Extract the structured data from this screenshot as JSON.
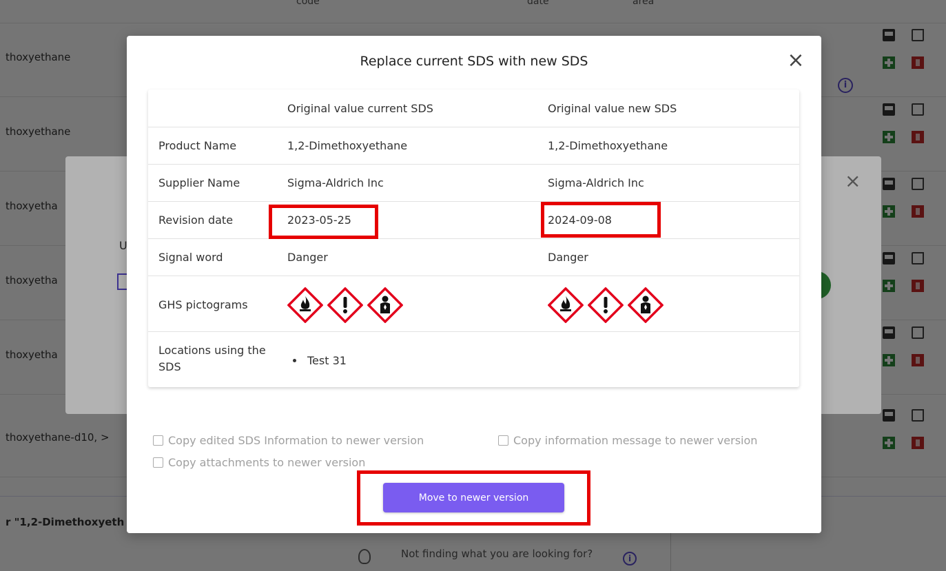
{
  "background": {
    "row_names": [
      "thoxyethane",
      "thoxyethane",
      "thoxyetha",
      "thoxyetha",
      "thoxyetha",
      "thoxyethane-d10, >"
    ],
    "bottom_title": "r \"1,2-Dimethoxyeth",
    "tip_text": "Not finding what you are looking for?",
    "info_symbol": "i",
    "header_labels": [
      "code",
      "date",
      "area"
    ]
  },
  "back_modal": {
    "close_symbol": "×",
    "u_letter": "U"
  },
  "modal": {
    "title": "Replace current SDS with new SDS",
    "close_symbol": "×",
    "table": {
      "col_current": "Original value current SDS",
      "col_new": "Original value new SDS",
      "rows": [
        {
          "label": "Product Name",
          "current": "1,2-Dimethoxyethane",
          "new": "1,2-Dimethoxyethane"
        },
        {
          "label": "Supplier Name",
          "current": "Sigma-Aldrich Inc",
          "new": "Sigma-Aldrich Inc"
        },
        {
          "label": "Revision date",
          "current": "2023-05-25",
          "new": "2024-09-08"
        },
        {
          "label": "Signal word",
          "current": "Danger",
          "new": "Danger"
        }
      ],
      "ghs_label": "GHS pictograms",
      "ghs_current": [
        "flame-pictogram",
        "exclamation-pictogram",
        "health-hazard-pictogram"
      ],
      "ghs_new": [
        "flame-pictogram",
        "exclamation-pictogram",
        "health-hazard-pictogram"
      ],
      "locations_label": "Locations using the SDS",
      "locations": [
        "Test 31"
      ]
    },
    "options": {
      "copy_edited": "Copy edited SDS Information to newer version",
      "copy_info_message": "Copy information message to newer version",
      "copy_attachments": "Copy attachments to newer version"
    },
    "move_button": "Move to newer version"
  },
  "colors": {
    "accent": "#7a5cf0",
    "highlight": "#e60000",
    "ghs_red": "#e3001b"
  }
}
